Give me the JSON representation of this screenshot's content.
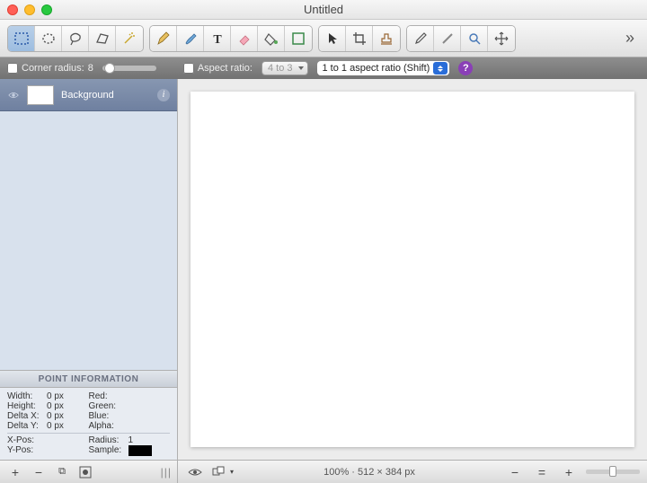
{
  "window": {
    "title": "Untitled"
  },
  "toolbar": {
    "tools": [
      {
        "name": "rect-select",
        "selected": true
      },
      {
        "name": "ellipse-select"
      },
      {
        "name": "lasso-select"
      },
      {
        "name": "poly-select"
      },
      {
        "name": "wand-select"
      }
    ],
    "tools2": [
      {
        "name": "pencil"
      },
      {
        "name": "brush"
      },
      {
        "name": "text"
      },
      {
        "name": "eraser"
      },
      {
        "name": "fill"
      },
      {
        "name": "shape"
      }
    ],
    "tools3": [
      {
        "name": "pointer"
      },
      {
        "name": "crop"
      },
      {
        "name": "stamp"
      }
    ],
    "tools4": [
      {
        "name": "eyedropper"
      },
      {
        "name": "heal"
      },
      {
        "name": "zoom"
      },
      {
        "name": "move"
      }
    ]
  },
  "options": {
    "corner_radius_label": "Corner radius:",
    "corner_radius_value": "8",
    "aspect_ratio_label": "Aspect ratio:",
    "aspect_ratio_options": "4 to 3",
    "shift_label": "1 to 1 aspect ratio (Shift)",
    "help": "?"
  },
  "layers": {
    "items": [
      {
        "name": "Background"
      }
    ]
  },
  "pointinfo": {
    "header": "POINT INFORMATION",
    "width_label": "Width:",
    "width": "0 px",
    "height_label": "Height:",
    "height": "0 px",
    "dx_label": "Delta X:",
    "dx": "0 px",
    "dy_label": "Delta Y:",
    "dy": "0 px",
    "xpos_label": "X-Pos:",
    "xpos": "",
    "ypos_label": "Y-Pos:",
    "ypos": "",
    "red_label": "Red:",
    "red": "",
    "green_label": "Green:",
    "green": "",
    "blue_label": "Blue:",
    "blue": "",
    "alpha_label": "Alpha:",
    "alpha": "",
    "radius_label": "Radius:",
    "radius": "1",
    "sample_label": "Sample:"
  },
  "status": {
    "text": "100% · 512 × 384 px"
  }
}
